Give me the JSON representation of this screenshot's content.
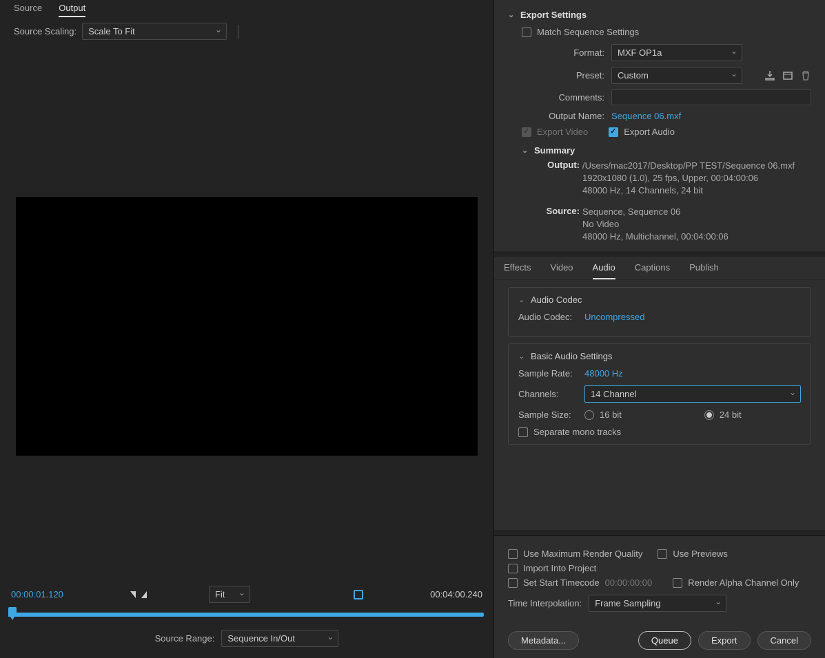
{
  "leftTabs": {
    "source": "Source",
    "output": "Output"
  },
  "scaling": {
    "label": "Source Scaling:",
    "value": "Scale To Fit"
  },
  "playback": {
    "currentTc": "00:00:01.120",
    "durationTc": "00:04:00.240",
    "fit": "Fit",
    "sourceRangeLabel": "Source Range:",
    "sourceRangeValue": "Sequence In/Out"
  },
  "exportSettings": {
    "title": "Export Settings",
    "matchLabel": "Match Sequence Settings",
    "formatLabel": "Format:",
    "formatValue": "MXF OP1a",
    "presetLabel": "Preset:",
    "presetValue": "Custom",
    "commentsLabel": "Comments:",
    "outputNameLabel": "Output Name:",
    "outputNameValue": "Sequence 06.mxf",
    "exportVideo": "Export Video",
    "exportAudio": "Export Audio"
  },
  "summary": {
    "title": "Summary",
    "outputLabel": "Output:",
    "outputLine1": "/Users/mac2017/Desktop/PP TEST/Sequence 06.mxf",
    "outputLine2": "1920x1080 (1.0), 25 fps, Upper, 00:04:00:06",
    "outputLine3": "48000 Hz, 14 Channels, 24 bit",
    "sourceLabel": "Source:",
    "sourceLine1": "Sequence, Sequence 06",
    "sourceLine2": "No Video",
    "sourceLine3": "48000 Hz, Multichannel, 00:04:00:06"
  },
  "midTabs": {
    "effects": "Effects",
    "video": "Video",
    "audio": "Audio",
    "captions": "Captions",
    "publish": "Publish"
  },
  "audioCodec": {
    "title": "Audio Codec",
    "label": "Audio Codec:",
    "value": "Uncompressed"
  },
  "basicAudio": {
    "title": "Basic Audio Settings",
    "sampleRateLabel": "Sample Rate:",
    "sampleRateValue": "48000 Hz",
    "channelsLabel": "Channels:",
    "channelsValue": "14 Channel",
    "sampleSizeLabel": "Sample Size:",
    "size16": "16 bit",
    "size24": "24 bit",
    "separateMono": "Separate mono tracks"
  },
  "bottomOpts": {
    "useMax": "Use Maximum Render Quality",
    "usePrev": "Use Previews",
    "importInto": "Import Into Project",
    "setStart": "Set Start Timecode",
    "startTc": "00:00:00:00",
    "renderAlpha": "Render Alpha Channel Only",
    "timeInterpLabel": "Time Interpolation:",
    "timeInterpValue": "Frame Sampling"
  },
  "buttons": {
    "metadata": "Metadata...",
    "queue": "Queue",
    "export": "Export",
    "cancel": "Cancel"
  }
}
